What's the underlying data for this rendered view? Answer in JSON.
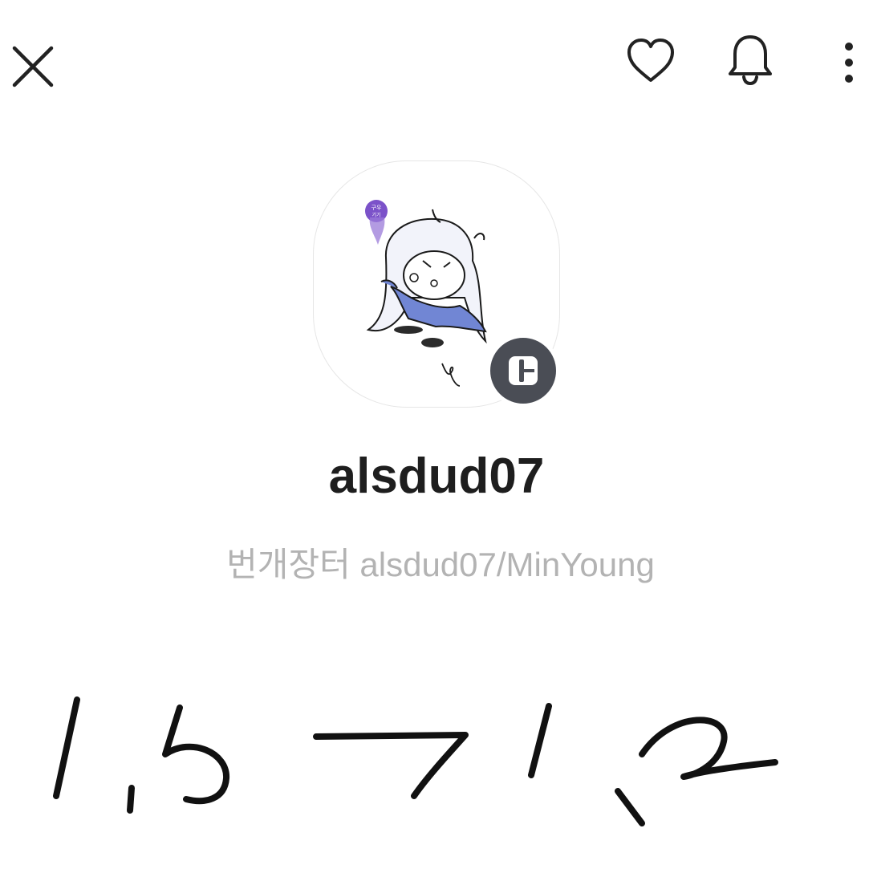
{
  "header": {
    "close_icon": "close-icon",
    "favorite_icon": "heart-icon",
    "notify_icon": "bell-icon",
    "more_icon": "more-vertical-icon"
  },
  "profile": {
    "avatar": "profile-avatar-illustration",
    "badge_icon": "bunjang-shop-icon",
    "username": "alsdud07",
    "subtitle": "번개장터 alsdud07/MinYoung"
  },
  "annotation": {
    "handwritten_note": "1,5 → 1,2"
  },
  "colors": {
    "text_primary": "#1e1e1e",
    "text_secondary": "#b3b3b3",
    "badge_bg": "#4a4d55",
    "avatar_accent": "#6a7bd0"
  }
}
